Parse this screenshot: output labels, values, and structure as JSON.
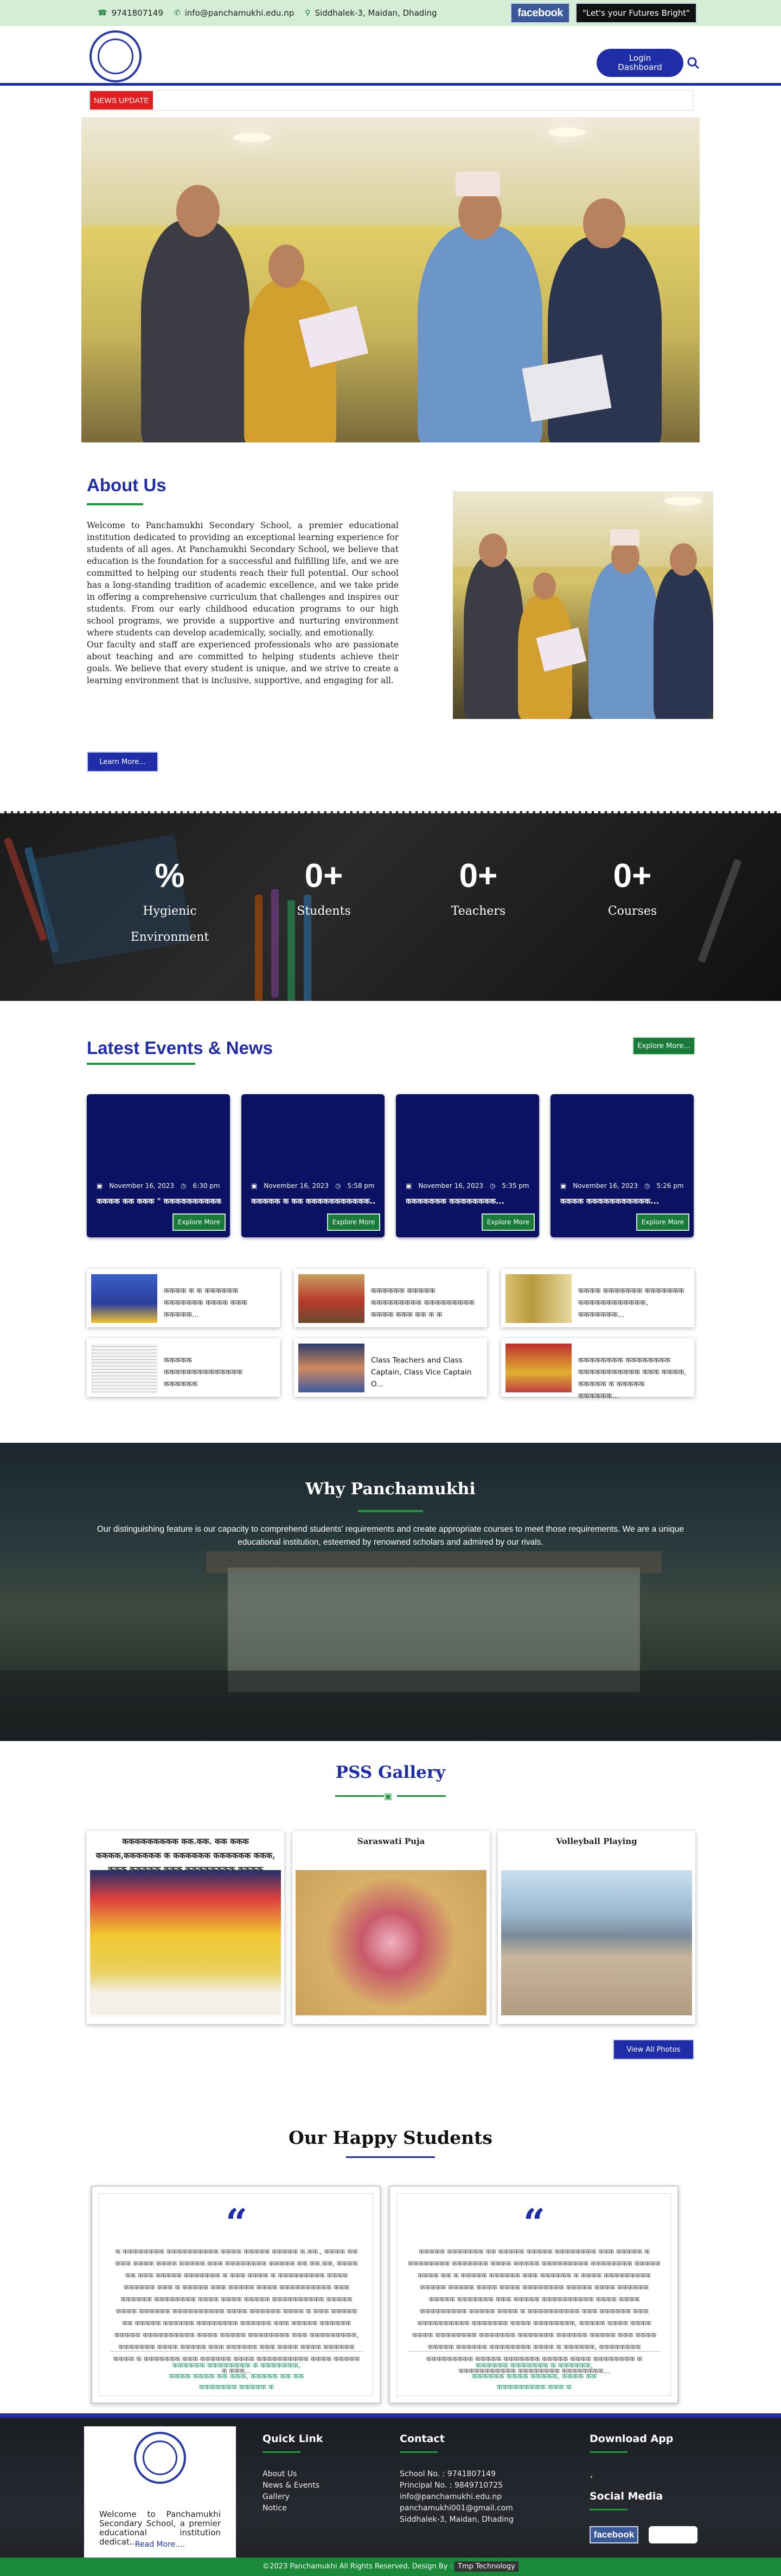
{
  "topbar": {
    "phone": "9741807149",
    "email": "info@panchamukhi.edu.np",
    "address": "Siddhalek-3, Maidan, Dhading",
    "facebook_label": "facebook",
    "tagline": "\"Let's your Futures Bright\""
  },
  "header": {
    "login_label_1": "Login",
    "login_label_2": "Dashboard"
  },
  "news_strip": {
    "label": "NEWS UPDATE"
  },
  "about": {
    "title": "About Us",
    "paragraph_1": "Welcome to Panchamukhi Secondary School, a premier educational institution dedicated to providing an exceptional learning experience for students of all ages. At Panchamukhi Secondary School, we believe that education is the foundation for a successful and fulfilling life, and we are committed to helping our students reach their full potential. Our school has a long-standing tradition of academic excellence, and we take pride in offering a comprehensive curriculum that challenges and inspires our students. From our early childhood education programs to our high school programs, we provide a supportive and nurturing environment where students can develop academically, socially, and emotionally.",
    "paragraph_2": "Our faculty and staff are experienced professionals who are passionate about teaching and are committed to helping students achieve their goals. We believe that every student is unique, and we strive to create a learning environment that is inclusive, supportive, and engaging for all.",
    "learn_more": "Learn More..."
  },
  "stats": [
    {
      "value": "%",
      "label_1": "Hygienic",
      "label_2": "Environment"
    },
    {
      "value": "0+",
      "label_1": "Students",
      "label_2": ""
    },
    {
      "value": "0+",
      "label_1": "Teachers",
      "label_2": ""
    },
    {
      "value": "0+",
      "label_1": "Courses",
      "label_2": ""
    }
  ],
  "events": {
    "title": "Latest Events & News",
    "explore_more": "Explore More...",
    "cards": [
      {
        "date": "November 16, 2023",
        "time": "6:30 pm",
        "title": "कककक कक ककक \" ककककककककककककक...",
        "button": "Explore More"
      },
      {
        "date": "November 16, 2023",
        "time": "5:58 pm",
        "title": "ककककक क कक ककककककककककक...",
        "button": "Explore More"
      },
      {
        "date": "November 16, 2023",
        "time": "5:35 pm",
        "title": "ककककककक कककककककक...",
        "button": "Explore More"
      },
      {
        "date": "November 16, 2023",
        "time": "5:26 pm",
        "title": "कककक ककककककककककक...",
        "button": "Explore More"
      }
    ],
    "news_items": [
      {
        "text": "कककक क क कककककक ककककककक कककक ककक ककककक..."
      },
      {
        "text": "कककककक ककककक ककककककककक ककककककककक कककक ककक कक क क"
      },
      {
        "text": "कककक ककककककक ककककककक कककककककककककक, ककककककक..."
      },
      {
        "text": "ककककक कककककककककककककक कककककक"
      },
      {
        "text": "Class Teachers and Class Captain, Class Vice Captain O..."
      },
      {
        "text": "कककककककक कककककककक ककककककककककक ककक कककक, ककककक क ककककक कककककक..."
      }
    ]
  },
  "why": {
    "title": "Why Panchamukhi",
    "text": "Our distinguishing feature is our capacity to comprehend students' requirements and create appropriate courses to meet those requirements. We are a unique educational institution, esteemed by renowned scholars and admired by our rivals."
  },
  "gallery": {
    "title": "PSS Gallery",
    "items": [
      {
        "title": "ककककककककक कक.कक. कक ककक कककक,कककककक क कककककक कककककक ककक, ककक ककककक ककक कककककककक कककक ककककक..."
      },
      {
        "title": "Saraswati Puja"
      },
      {
        "title": "Volleyball Playing"
      }
    ],
    "view_all": "View All Photos"
  },
  "students": {
    "title": "Our Happy Students",
    "quote_mark": "“",
    "cards": [
      {
        "body": "क कककककककक कककककककककक कककक ककककक ककककक क.कक., कककक कक ककक कककक कककक ककककक ककक कककककककक ककककक कक कक.कक, कककक कक ककक ककककक ककककककक क ककक कककक क ककककककककक कककक कककककक ककक क ककककक ककक ककककक कककक कककककककककक ककक कककककक कककककककक कककक कककक ककककक कककककककककक ककककक कककक कककककक कककककककककक कककक कककककक कककक क ककक ककककक कक ककककक कककककक कककककककक कककककक ककक ककककक कककककक ककककक कककककककककक कककक ककककक कककककककक ककक ककककककककक, ककककककक कककक ककककक ककक कककककक ककक कककक कककक कककककक कककक क ककककककक ककक कककककक कककक कककककककककक कककक ककककक क ककक...",
        "name_line_1": "कककककक कककककककक क ककककककक,",
        "name_line_2": "कककक कककक कक ककक, ककककक कक कक",
        "name_line_3": "ककककककक ककककक क"
      },
      {
        "body": "ककककक ककककककक कक ककककक ककककक कककककककक ककक ककककक क कककककककक ककककककक कककक ककककक ककककककककक कककककककक ककककक कककक कक क ककककक कककककक ककक कककककक क कककक ककककककककक ककककक ककककक कककक कककक कककककककक ककककक कककक कककककक ककककक ककककककक ककक ककककक कककककककककक कककक कककक ककककककककक ककककक कककक क कककककककककक ककक कककककक ककक कककककककककक ककककककक कककक कककककककक, ककककक कककक कककक कककक कककककककक ककककककक ककककककक कककककक ककककक ककक कककक ककककक कककककक कककककककक कककक क कककककक, कककककककक ककककककककक ककककक ककककककक ककककक कककक कककककककक क ककककककककककक कककककककक कककककककक...",
        "name_line_1": "कककककक ककककककक क कककककक,",
        "name_line_2": "कककककक कककक ककककक, कककक कक",
        "name_line_3": "ककककककककक ककक क"
      }
    ]
  },
  "footer": {
    "about_text": "Welcome to Panchamukhi Secondary School, a premier educational institution dedicat...",
    "read_more": "Read More....",
    "quick_link_title": "Quick Link",
    "quick_links": [
      "About Us",
      "News & Events",
      "Gallery",
      "Notice"
    ],
    "contact_title": "Contact",
    "contact_lines": [
      "School No. : 9741807149",
      "Principal No. : 9849710725",
      "info@panchamukhi.edu.np",
      "panchamukhi001@gmail.com",
      "Siddhalek-3, Maidan, Dhading"
    ],
    "download_title": "Download App",
    "download_bullet": "·",
    "social_title": "Social Media",
    "facebook_label": "facebook",
    "copyright": "©2023 Panchamukhi All Rights Reserved. Design By :",
    "developer": "Tmp Technology"
  },
  "colors": {
    "primary_blue": "#1f2ea8",
    "green": "#1a7a3a",
    "event_card": "#0b1163",
    "news_red": "#e02020",
    "topbar_bg": "#d4edd5"
  }
}
